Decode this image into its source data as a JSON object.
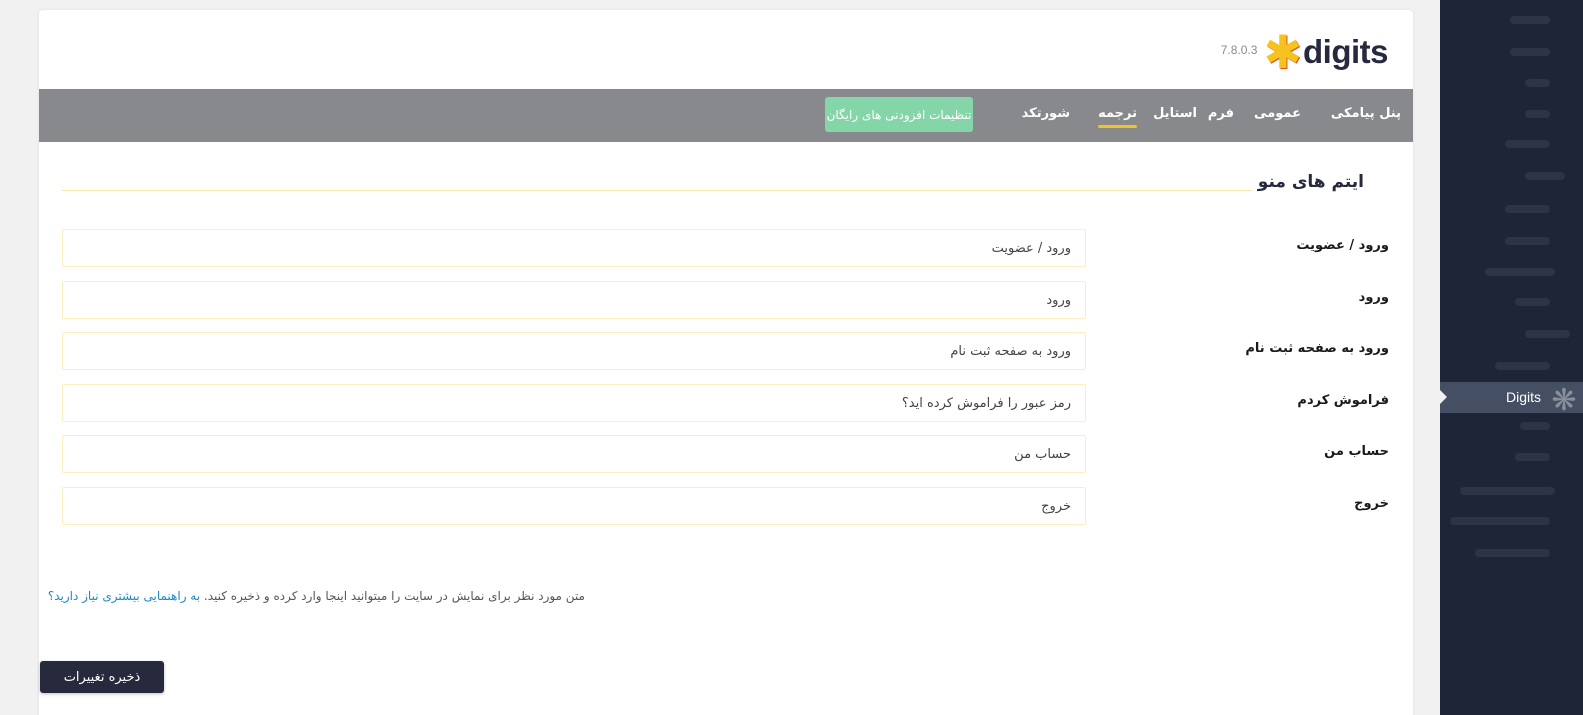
{
  "brand": {
    "logo_text": "digits",
    "version": "7.8.0.3",
    "accent_color": "#f6c21f"
  },
  "nav": {
    "items": [
      {
        "label": "پنل پیامکی",
        "active": false
      },
      {
        "label": "عمومی",
        "active": false
      },
      {
        "label": "فرم",
        "active": false
      },
      {
        "label": "استایل",
        "active": false
      },
      {
        "label": "ترجمه",
        "active": true
      },
      {
        "label": "شورتکد",
        "active": false
      }
    ],
    "addon_button": "تنظیمات افزودنی های رایگان"
  },
  "section": {
    "title": "ایتم های منو"
  },
  "fields": [
    {
      "label": "ورود / عضویت",
      "value": "ورود / عضویت"
    },
    {
      "label": "ورود",
      "value": "ورود"
    },
    {
      "label": "ورود به صفحه ثبت نام",
      "value": "ورود به صفحه ثبت نام"
    },
    {
      "label": "فراموش کردم",
      "value": "رمز عبور را فراموش کرده اید؟"
    },
    {
      "label": "حساب من",
      "value": "حساب من"
    },
    {
      "label": "خروج",
      "value": "خروج"
    }
  ],
  "help": {
    "text": "متن مورد نظر برای نمایش در سایت را میتوانید اینجا وارد کرده و ذخیره کنید.",
    "link": "به راهنمایی بیشتری نیاز دارید؟"
  },
  "save_button": "ذخیره تغییرات",
  "wp_sidebar": {
    "active_item": "Digits",
    "active_icon": "digits-asterisk-icon"
  }
}
